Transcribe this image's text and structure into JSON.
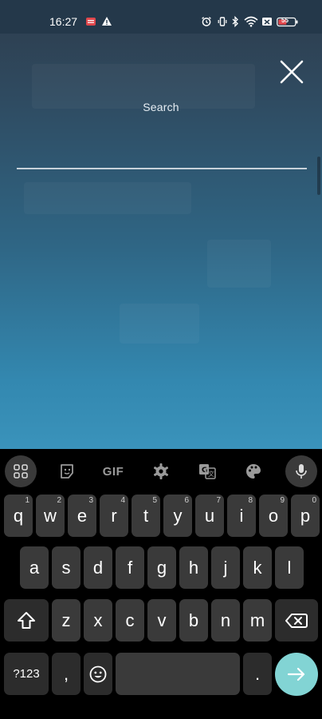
{
  "status_bar": {
    "time": "16:27",
    "battery": "55"
  },
  "search": {
    "label": "Search",
    "placeholder": "",
    "value": ""
  },
  "keyboard": {
    "toolbar": {
      "gif_label": "GIF"
    },
    "row1": [
      {
        "key": "q",
        "hint": "1"
      },
      {
        "key": "w",
        "hint": "2"
      },
      {
        "key": "e",
        "hint": "3"
      },
      {
        "key": "r",
        "hint": "4"
      },
      {
        "key": "t",
        "hint": "5"
      },
      {
        "key": "y",
        "hint": "6"
      },
      {
        "key": "u",
        "hint": "7"
      },
      {
        "key": "i",
        "hint": "8"
      },
      {
        "key": "o",
        "hint": "9"
      },
      {
        "key": "p",
        "hint": "0"
      }
    ],
    "row2": [
      "a",
      "s",
      "d",
      "f",
      "g",
      "h",
      "j",
      "k",
      "l"
    ],
    "row3": [
      "z",
      "x",
      "c",
      "v",
      "b",
      "n",
      "m"
    ],
    "symbols_label": "?123",
    "comma_label": ",",
    "period_label": "."
  },
  "colors": {
    "accent_go": "#82d4d4",
    "key_bg": "#3a3a3a",
    "keyboard_bg": "#000000"
  }
}
